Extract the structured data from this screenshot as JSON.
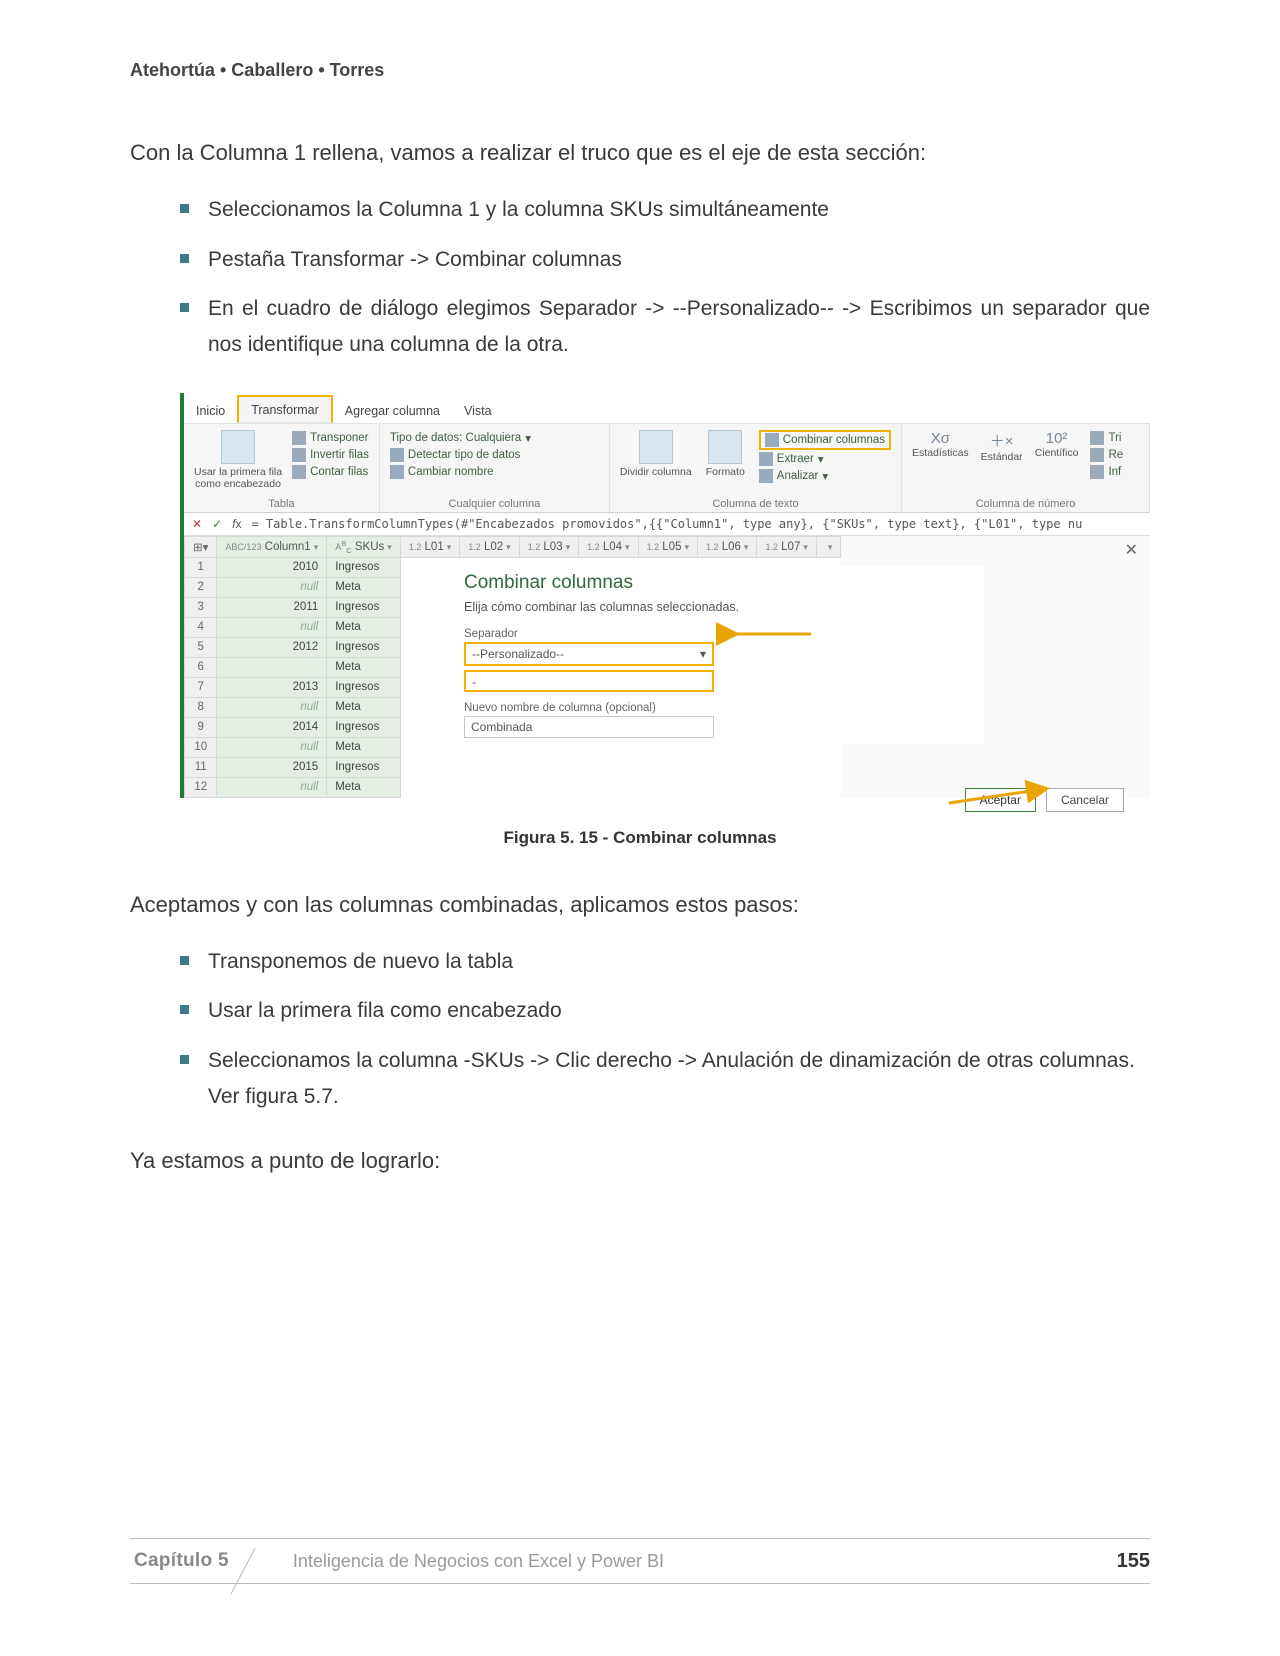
{
  "authors": "Atehortúa • Caballero • Torres",
  "intro": "Con la Columna 1 rellena, vamos a realizar el truco que es el eje de esta sección:",
  "bullets1": [
    "Seleccionamos la Columna 1 y la columna SKUs simultáneamente",
    "Pestaña Transformar -> Combinar columnas",
    "En el cuadro de diálogo elegimos Separador -> --Personalizado-- -> Escribimos un separador que nos identifique una columna de la otra."
  ],
  "ribbon": {
    "tabs": [
      "Inicio",
      "Transformar",
      "Agregar columna",
      "Vista"
    ],
    "active_tab": "Transformar",
    "grp_tabla": {
      "items": [
        "Transponer",
        "Invertir filas",
        "Contar filas"
      ],
      "fila1": "Usar la primera fila",
      "fila2": "como encabezado",
      "label": "Tabla"
    },
    "grp_col": {
      "tipo": "Tipo de datos: Cualquiera",
      "detect": "Detectar tipo de datos",
      "rename": "Cambiar nombre",
      "label": "Cualquier columna"
    },
    "grp_text": {
      "divide": "Dividir columna",
      "format": "Formato",
      "combine": "Combinar columnas",
      "extract": "Extraer",
      "analyze": "Analizar",
      "label": "Columna de texto"
    },
    "grp_num": {
      "stats": "Estadísticas",
      "std": "Estándar",
      "sci": "Científico",
      "label": "Columna de número",
      "tri": "Tri",
      "re": "Re",
      "inf": "Inf"
    }
  },
  "fx": "= Table.TransformColumnTypes(#\"Encabezados promovidos\",{{\"Column1\", type any}, {\"SKUs\", type text}, {\"L01\", type nu",
  "grid": {
    "headers": [
      "Column1",
      "SKUs",
      "L01",
      "L02",
      "L03",
      "L04",
      "L05",
      "L06",
      "L07"
    ],
    "type_prefix": [
      "ABC/123",
      "A",
      "1.2",
      "1.2",
      "1.2",
      "1.2",
      "1.2",
      "1.2",
      "1.2"
    ],
    "rows": [
      [
        "2010",
        "Ingresos"
      ],
      [
        "null",
        "Meta"
      ],
      [
        "2011",
        "Ingresos"
      ],
      [
        "null",
        "Meta"
      ],
      [
        "2012",
        "Ingresos"
      ],
      [
        "",
        "Meta"
      ],
      [
        "2013",
        "Ingresos"
      ],
      [
        "null",
        "Meta"
      ],
      [
        "2014",
        "Ingresos"
      ],
      [
        "null",
        "Meta"
      ],
      [
        "2015",
        "Ingresos"
      ],
      [
        "null",
        "Meta"
      ]
    ]
  },
  "dialog": {
    "title": "Combinar columnas",
    "subtitle": "Elija cómo combinar las columnas seleccionadas.",
    "sep_label": "Separador",
    "sep_value": "--Personalizado--",
    "custom_value": "-",
    "name_label": "Nuevo nombre de columna (opcional)",
    "name_value": "Combinada",
    "ok": "Aceptar",
    "cancel": "Cancelar"
  },
  "caption": "Figura 5. 15 -  Combinar columnas",
  "after": "Aceptamos y con las columnas combinadas, aplicamos estos pasos:",
  "bullets2": [
    "Transponemos de nuevo la tabla",
    "Usar la primera fila como encabezado",
    "Seleccionamos la columna -SKUs -> Clic derecho -> Anulación de dinamización de otras columnas. Ver figura 5.7."
  ],
  "closing": "Ya estamos a punto de lograrlo:",
  "footer": {
    "chapter": "Capítulo 5",
    "book": "Inteligencia de Negocios con Excel y Power BI",
    "page": "155"
  }
}
